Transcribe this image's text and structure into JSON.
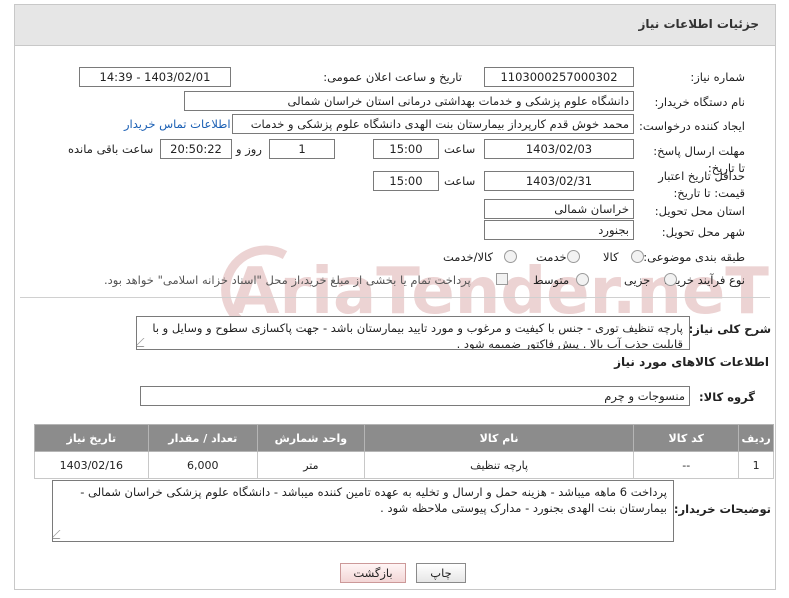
{
  "header": {
    "title": "جزئیات اطلاعات نیاز"
  },
  "fields": {
    "need_number_label": "شماره نیاز:",
    "need_number": "1103000257000302",
    "announce_label": "تاریخ و ساعت اعلان عمومی:",
    "announce_value": "1403/02/01 - 14:39",
    "buyer_label": "نام دستگاه خریدار:",
    "buyer_value": "دانشگاه علوم پزشکی و خدمات بهداشتی درمانی استان خراسان شمالی",
    "creator_label": "ایجاد کننده درخواست:",
    "creator_value": "محمد خوش قدم کارپرداز بیمارستان بنت الهدی دانشگاه علوم پزشکی و خدمات",
    "contact_link": "اطلاعات تماس خریدار",
    "deadline_label": "مهلت ارسال پاسخ: تا تاریخ:",
    "deadline_date": "1403/02/03",
    "time_label": "ساعت",
    "deadline_time": "15:00",
    "days_value": "1",
    "days_label": "روز و",
    "remaining_time": "20:50:22",
    "remaining_label": "ساعت باقی مانده",
    "validity_label": "حداقل تاریخ اعتبار قیمت: تا تاریخ:",
    "validity_date": "1403/02/31",
    "validity_time": "15:00",
    "province_label": "استان محل تحویل:",
    "province_value": "خراسان شمالی",
    "city_label": "شهر محل تحویل:",
    "city_value": "بجنورد",
    "category_label": "طبقه بندی موضوعی:",
    "category_options": [
      "کالا",
      "خدمت",
      "کالا/خدمت"
    ],
    "process_label": "نوع فرآیند خرید :",
    "process_options": [
      "جزیی",
      "متوسط"
    ],
    "payment_note": "پرداخت تمام یا بخشی از مبلغ خرید،از محل \"اسناد خزانه اسلامی\" خواهد بود."
  },
  "description": {
    "label": "شرح کلی نیاز:",
    "text": "پارچه تنظیف توری - جنس با کیفیت و مرغوب و مورد تایید بیمارستان باشد - جهت پاکسازی سطوح و وسایل و با قابلیت جذب آب بالا . پیش فاکتور ضمیمه شود ."
  },
  "goods": {
    "section_title": "اطلاعات کالاهای مورد نیاز",
    "group_label": "گروه کالا:",
    "group_value": "منسوجات و چرم",
    "columns": [
      "ردیف",
      "کد کالا",
      "نام کالا",
      "واحد شمارش",
      "تعداد / مقدار",
      "تاریخ نیاز"
    ],
    "rows": [
      {
        "index": "1",
        "code": "--",
        "name": "پارچه تنظیف",
        "unit": "متر",
        "qty": "6,000",
        "date": "1403/02/16"
      }
    ]
  },
  "buyer_notes": {
    "label": "توضیحات خریدار:",
    "text": "پرداخت 6 ماهه میباشد - هزینه حمل و ارسال و تخلیه به عهده تامین کننده میباشد - دانشگاه علوم پزشکی خراسان شمالی - بیمارستان بنت الهدی بجنورد - مدارک پیوستی ملاحظه شود ."
  },
  "buttons": {
    "print": "چاپ",
    "back": "بازگشت"
  },
  "watermark": {
    "text": "AriaTender.neT"
  },
  "colors": {
    "header_bg": "#e6e6e6",
    "table_header_bg": "#8c8c8c",
    "link": "#1a5fb4",
    "watermark": "#e7c9c9"
  }
}
